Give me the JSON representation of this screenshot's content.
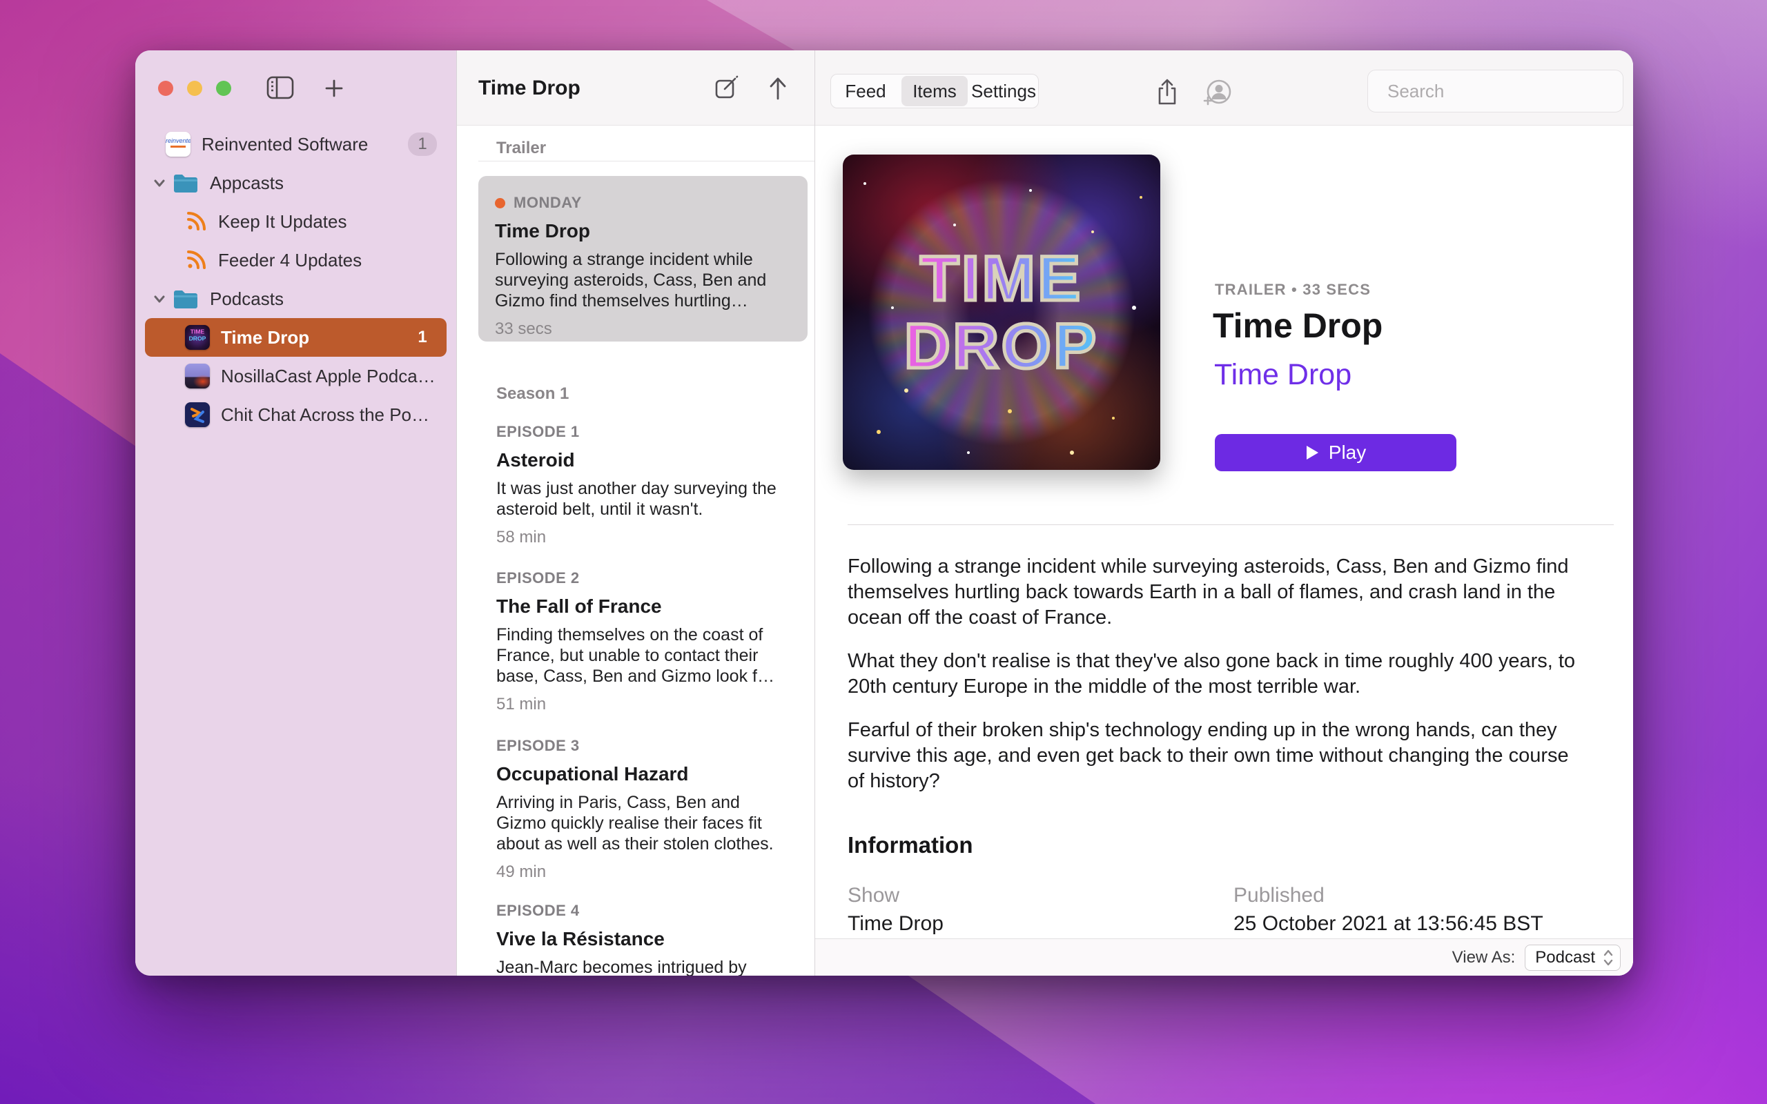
{
  "colors": {
    "accent_purple": "#6D2AE3",
    "link_purple": "#6F2FE8",
    "sidebar_selected_orange": "#BC5A2C",
    "rss_orange": "#EE7F1B",
    "folder_teal": "#3A93BA",
    "unread_dot_orange": "#E8652F",
    "sidebar_pink": "#E9D4E9"
  },
  "icons": {
    "traffic": [
      "close",
      "minimize",
      "zoom"
    ],
    "sidebar_toolbar": [
      "sidebar-toggle",
      "plus"
    ],
    "list_toolbar": [
      "compose",
      "upload-arrow"
    ],
    "main_toolbar": [
      "share",
      "add-person",
      "search"
    ],
    "misc": [
      "chevron-down",
      "folder",
      "rss",
      "play-triangle",
      "stepper"
    ]
  },
  "sidebar": {
    "items": [
      {
        "label": "Reinvented Software",
        "badge": "1",
        "type": "app"
      },
      {
        "label": "Appcasts",
        "type": "folder"
      },
      {
        "label": "Keep It Updates",
        "type": "rss"
      },
      {
        "label": "Feeder 4 Updates",
        "type": "rss"
      },
      {
        "label": "Podcasts",
        "type": "folder"
      },
      {
        "label": "Time Drop",
        "badge": "1",
        "type": "podcast",
        "selected": true
      },
      {
        "label": "NosillaCast Apple Podca…",
        "type": "podcast"
      },
      {
        "label": "Chit Chat Across the Po…",
        "type": "podcast"
      }
    ]
  },
  "list_pane": {
    "title": "Time Drop",
    "sections": {
      "trailer": "Trailer",
      "season": "Season 1"
    },
    "trailer_item": {
      "day": "MONDAY",
      "title": "Time Drop",
      "desc": "Following a strange incident while surveying asteroids, Cass, Ben and Gizmo find themselves hurtling…",
      "duration": "33 secs"
    },
    "episodes": [
      {
        "kicker": "EPISODE 1",
        "title": "Asteroid",
        "desc": "It was just another day surveying the asteroid belt, until it wasn't.",
        "duration": "58 min"
      },
      {
        "kicker": "EPISODE 2",
        "title": "The Fall of France",
        "desc": "Finding themselves on the coast of France, but unable to contact their base, Cass, Ben and Gizmo look f…",
        "duration": "51 min"
      },
      {
        "kicker": "EPISODE 3",
        "title": "Occupational Hazard",
        "desc": "Arriving in Paris, Cass, Ben and Gizmo quickly realise their faces fit about as well as their stolen clothes.",
        "duration": "49 min"
      },
      {
        "kicker": "EPISODE 4",
        "title": "Vive la Résistance",
        "desc": "Jean-Marc becomes intrigued by",
        "duration": ""
      }
    ]
  },
  "main_pane": {
    "tabs": [
      "Feed",
      "Items",
      "Settings"
    ],
    "selected_tab": "Items",
    "search_placeholder": "Search",
    "artwork": {
      "line1": "TIME",
      "line2": "DROP"
    },
    "detail": {
      "kicker": "TRAILER • 33 SECS",
      "title": "Time Drop",
      "show_link": "Time Drop",
      "play_label": "Play",
      "paragraphs": [
        "Following a strange incident while surveying asteroids, Cass, Ben and Gizmo find themselves hurtling back towards Earth in a ball of flames, and crash land in the ocean off the coast of France.",
        "What they don't realise is that they've also gone back in time roughly 400 years, to 20th century Europe in the middle of the most terrible war.",
        "Fearful of their broken ship's technology ending up in the wrong hands, can they survive this age, and even get back to their own time without changing the course of history?"
      ],
      "information": {
        "heading": "Information",
        "fields": [
          {
            "label": "Show",
            "value": "Time Drop"
          },
          {
            "label": "Published",
            "value": "25 October 2021 at 13:56:45 BST"
          }
        ]
      },
      "view_as": {
        "label": "View As:",
        "value": "Podcast"
      }
    }
  }
}
